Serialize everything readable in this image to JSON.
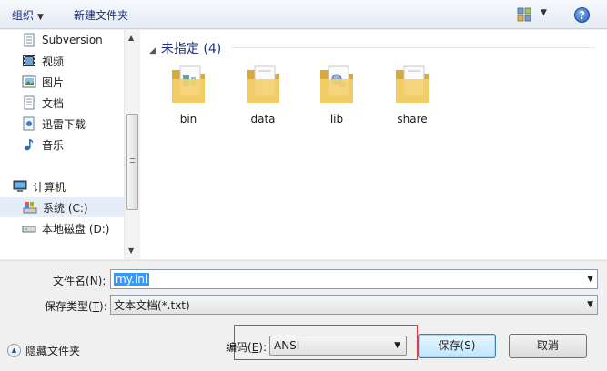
{
  "toolbar": {
    "organize_label": "组织",
    "new_folder_label": "新建文件夹",
    "views_icon": "views-icon",
    "help_icon": "help-icon"
  },
  "nav": {
    "items": [
      {
        "label": "Subversion",
        "icon": "subversion-icon"
      },
      {
        "label": "视频",
        "icon": "video-icon"
      },
      {
        "label": "图片",
        "icon": "pictures-icon"
      },
      {
        "label": "文档",
        "icon": "documents-icon"
      },
      {
        "label": "迅雷下载",
        "icon": "download-folder-icon"
      },
      {
        "label": "音乐",
        "icon": "music-icon"
      },
      {
        "label": "计算机",
        "icon": "computer-icon"
      },
      {
        "label": "系统 (C:)",
        "icon": "system-drive-icon",
        "selected": true
      },
      {
        "label": "本地磁盘 (D:)",
        "icon": "local-drive-icon"
      }
    ]
  },
  "content": {
    "group_header": "未指定 (4)",
    "folders": [
      {
        "name": "bin"
      },
      {
        "name": "data"
      },
      {
        "name": "lib"
      },
      {
        "name": "share"
      }
    ]
  },
  "form": {
    "filename_label_prefix": "文件名(",
    "filename_label_key": "N",
    "filename_label_suffix": "):",
    "filename_value": "my.ini",
    "filetype_label_prefix": "保存类型(",
    "filetype_label_key": "T",
    "filetype_label_suffix": "):",
    "filetype_value": "文本文档(*.txt)",
    "encoding_label_prefix": "编码(",
    "encoding_label_key": "E",
    "encoding_label_suffix": "):",
    "encoding_value": "ANSI"
  },
  "buttons": {
    "save": "保存(S)",
    "cancel": "取消",
    "hide_folders": "隐藏文件夹"
  },
  "colors": {
    "highlight_border": "#e0383e",
    "selection": "#3399ff",
    "link_text": "#1e3287"
  }
}
